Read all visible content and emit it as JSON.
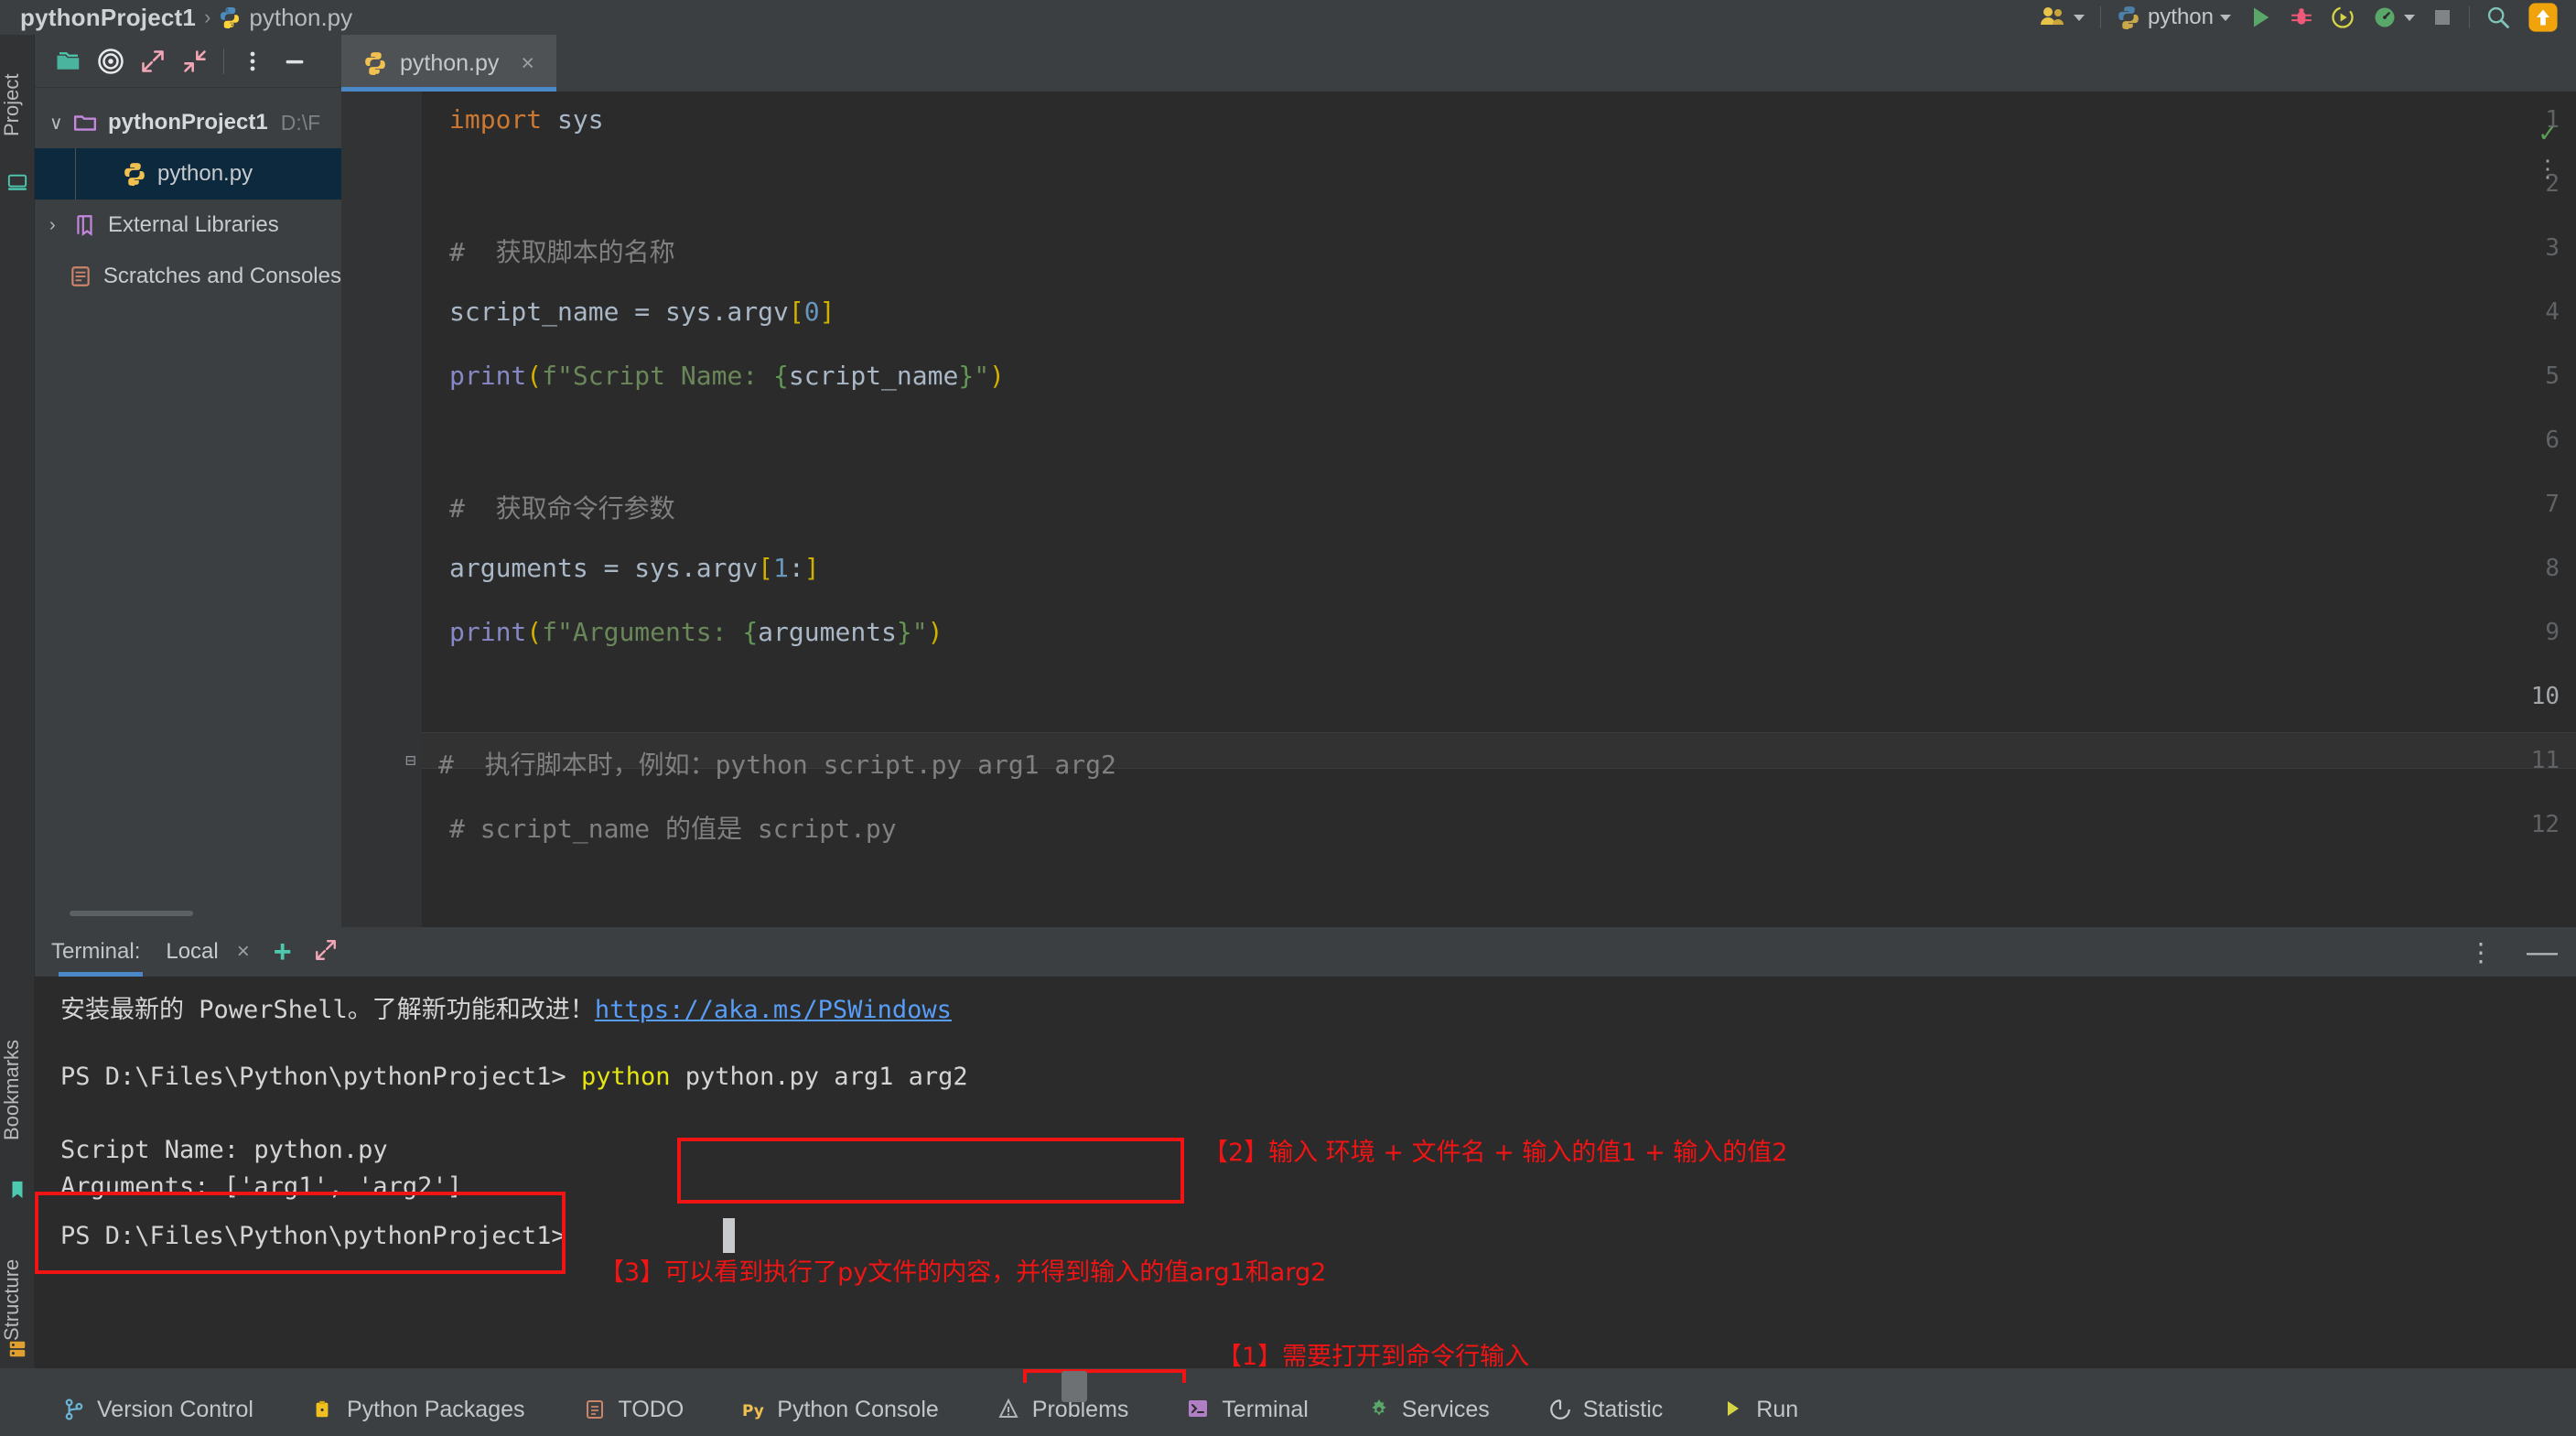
{
  "window": {
    "breadcrumb": {
      "project": "pythonProject1",
      "separator": "›",
      "file": "python.py"
    }
  },
  "toolbar_right": {
    "account_icon": "people-icon",
    "run_config": "python",
    "run_icon": "run-icon",
    "debug_icon": "debug-icon",
    "run_coverage_icon": "run-with-coverage-icon",
    "profile_icon": "profiler-icon",
    "stop_icon": "stop-icon",
    "search_icon": "search-icon",
    "update_icon": "update-icon"
  },
  "left_strip": {
    "project_label": "Project",
    "bookmarks_label": "Bookmarks",
    "structure_label": "Structure",
    "icons": [
      "remote-host-icon",
      "bookmark-icon",
      "database-icon"
    ]
  },
  "project_panel": {
    "toolbar": [
      {
        "name": "new-folder-icon"
      },
      {
        "name": "select-opened-file-icon"
      },
      {
        "name": "expand-all-icon"
      },
      {
        "name": "collapse-all-icon"
      },
      {
        "name": "more-options-icon"
      },
      {
        "name": "hide-panel-icon"
      }
    ],
    "tree": [
      {
        "label": "pythonProject1",
        "path": "D:\\F",
        "icon": "folder-icon",
        "arrow": "∨",
        "bold": true,
        "indent": false,
        "selected": false
      },
      {
        "label": "python.py",
        "path": "",
        "icon": "python-file-icon",
        "arrow": "",
        "bold": false,
        "indent": true,
        "selected": true
      },
      {
        "label": "External Libraries",
        "path": "",
        "icon": "library-icon",
        "arrow": "›",
        "bold": false,
        "indent": false,
        "selected": false
      },
      {
        "label": "Scratches and Consoles",
        "path": "",
        "icon": "scratches-icon",
        "arrow": "",
        "bold": false,
        "indent": false,
        "selected": false
      }
    ]
  },
  "editor": {
    "tab": {
      "label": "python.py",
      "icon": "python-file-icon",
      "close": "×"
    },
    "lines": [
      {
        "number": "1",
        "tokens": [
          {
            "t": "import ",
            "c": "kw"
          },
          {
            "t": "sys",
            "c": "pl"
          }
        ]
      },
      {
        "number": "2",
        "tokens": []
      },
      {
        "number": "3",
        "tokens": [
          {
            "t": "#  获取脚本的名称",
            "c": "cm"
          }
        ]
      },
      {
        "number": "4",
        "tokens": [
          {
            "t": "script_name = sys.argv",
            "c": "pl"
          },
          {
            "t": "[",
            "c": "brk"
          },
          {
            "t": "0",
            "c": "num"
          },
          {
            "t": "]",
            "c": "brk"
          }
        ]
      },
      {
        "number": "5",
        "tokens": [
          {
            "t": "print",
            "c": "fn"
          },
          {
            "t": "(",
            "c": "brk"
          },
          {
            "t": "f\"Script Name: ",
            "c": "str"
          },
          {
            "t": "{",
            "c": "brace"
          },
          {
            "t": "script_name",
            "c": "pl"
          },
          {
            "t": "}",
            "c": "brace"
          },
          {
            "t": "\"",
            "c": "str"
          },
          {
            "t": ")",
            "c": "brk"
          }
        ]
      },
      {
        "number": "6",
        "tokens": []
      },
      {
        "number": "7",
        "tokens": [
          {
            "t": "#  获取命令行参数",
            "c": "cm"
          }
        ]
      },
      {
        "number": "8",
        "tokens": [
          {
            "t": "arguments = sys.argv",
            "c": "pl"
          },
          {
            "t": "[",
            "c": "brk"
          },
          {
            "t": "1",
            "c": "num"
          },
          {
            "t": ":",
            "c": "pl"
          },
          {
            "t": "]",
            "c": "brk"
          }
        ]
      },
      {
        "number": "9",
        "tokens": [
          {
            "t": "print",
            "c": "fn"
          },
          {
            "t": "(",
            "c": "brk"
          },
          {
            "t": "f\"Arguments: ",
            "c": "str"
          },
          {
            "t": "{",
            "c": "brace"
          },
          {
            "t": "arguments",
            "c": "pl"
          },
          {
            "t": "}",
            "c": "brace"
          },
          {
            "t": "\"",
            "c": "str"
          },
          {
            "t": ")",
            "c": "brk"
          }
        ]
      },
      {
        "number": "10",
        "tokens": []
      },
      {
        "number": "11",
        "tokens": [
          {
            "t": "#  执行脚本时，例如：python script.py arg1 arg2",
            "c": "cm"
          }
        ]
      },
      {
        "number": "12",
        "tokens": [
          {
            "t": "# script_name 的值是 script.py",
            "c": "cm"
          }
        ]
      }
    ],
    "current_line": "10",
    "inspection_status": "✓"
  },
  "terminal": {
    "title": "Terminal:",
    "tab": "Local",
    "close": "×",
    "add": "+",
    "expand_icon": "expand-icon",
    "options_icon": "more-options-icon",
    "minimize_icon": "minimize-icon",
    "lines": [
      {
        "text": "安装最新的 PowerShell。了解新功能和改进！",
        "link": "https://aka.ms/PSWindows"
      },
      {
        "prompt": "PS D:\\Files\\Python\\pythonProject1> ",
        "cmd_kw": "python",
        "cmd_rest": " python.py arg1 arg2"
      },
      {
        "text": "Script Name: python.py"
      },
      {
        "text": "Arguments: ['arg1', 'arg2']"
      },
      {
        "prompt": "PS D:\\Files\\Python\\pythonProject1> ",
        "cmd_kw": "",
        "cmd_rest": ""
      }
    ]
  },
  "annotations": [
    {
      "id": "2",
      "text": "【2】输入 环境 + 文件名 + 输入的值1 + 输入的值2"
    },
    {
      "id": "3",
      "text": "【3】可以看到执行了py文件的内容，并得到输入的值arg1和arg2"
    },
    {
      "id": "1",
      "text": "【1】需要打开到命令行输入"
    }
  ],
  "status_bar": [
    {
      "label": "Version Control",
      "icon": "branch-icon"
    },
    {
      "label": "Python Packages",
      "icon": "package-icon"
    },
    {
      "label": "TODO",
      "icon": "todo-icon"
    },
    {
      "label": "Python Console",
      "icon": "python-console-icon"
    },
    {
      "label": "Problems",
      "icon": "problems-icon"
    },
    {
      "label": "Terminal",
      "icon": "terminal-icon"
    },
    {
      "label": "Services",
      "icon": "services-icon"
    },
    {
      "label": "Statistic",
      "icon": "statistic-icon"
    },
    {
      "label": "Run",
      "icon": "run-icon"
    }
  ],
  "colors": {
    "accent_blue": "#4a88c7",
    "annotation_red": "#f11414",
    "python_yellow": "#ffd43b",
    "python_blue": "#4b8bbe",
    "selection": "#0d293e"
  }
}
